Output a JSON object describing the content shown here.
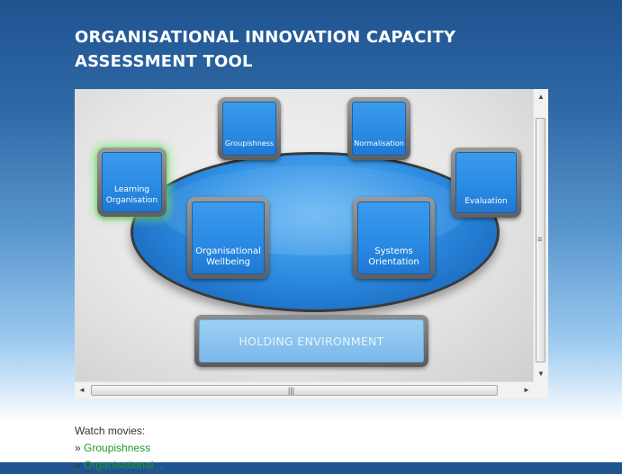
{
  "title": {
    "line1": "ORGANISATIONAL INNOVATION CAPACITY",
    "line2": "ASSESSMENT TOOL"
  },
  "diagram": {
    "nodes": {
      "groupishness": "Groupishness",
      "normalisation": "Normalisation",
      "learning_line1": "Learning",
      "learning_line2": "Organisation",
      "evaluation": "Evaluation",
      "wellbeing_line1": "Organisational",
      "wellbeing_line2": "Wellbeing",
      "systems_line1": "Systems",
      "systems_line2": "Orientation"
    },
    "holding_environment": "HOLDING ENVIRONMENT"
  },
  "scrollbars": {
    "up_arrow": "▲",
    "down_arrow": "▼",
    "left_arrow": "◄",
    "right_arrow": "►",
    "v_grip": "≡",
    "h_grip": "|||"
  },
  "movies": {
    "heading": "Watch movies:",
    "bullet": "»",
    "links": [
      "Groupishness",
      "Organisational ..."
    ]
  },
  "colors": {
    "node_blue": "#2a8ae3",
    "link_green": "#1e9a2a",
    "glow_green": "#78e66e"
  }
}
